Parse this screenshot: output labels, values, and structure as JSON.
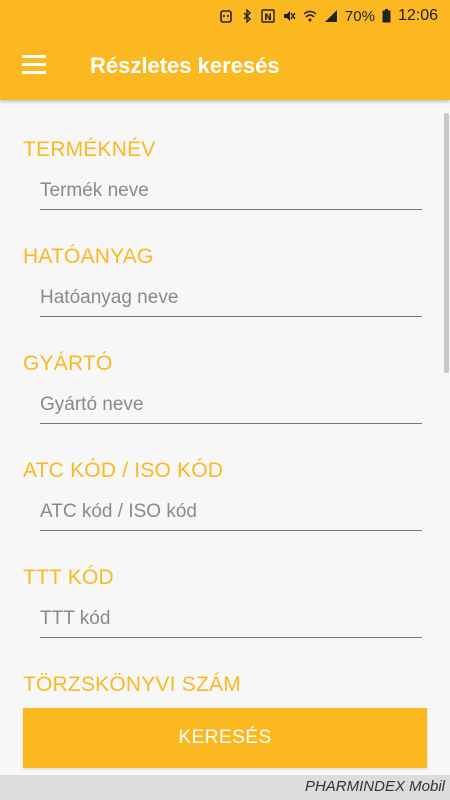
{
  "status_bar": {
    "battery": "70%",
    "time": "12:06",
    "icons": [
      "notification-icon",
      "bluetooth-icon",
      "nfc-icon",
      "mute-icon",
      "wifi-icon",
      "signal-icon",
      "battery-icon"
    ]
  },
  "app_bar": {
    "title": "Részletes keresés",
    "menu_icon": "hamburger-menu-icon"
  },
  "form": {
    "fields": [
      {
        "label": "TERMÉKNÉV",
        "placeholder": "Termék neve"
      },
      {
        "label": "HATÓANYAG",
        "placeholder": "Hatóanyag neve"
      },
      {
        "label": "GYÁRTÓ",
        "placeholder": "Gyártó neve"
      },
      {
        "label": "ATC KÓD / ISO KÓD",
        "placeholder": "ATC kód / ISO kód"
      },
      {
        "label": "TTT KÓD",
        "placeholder": "TTT kód"
      },
      {
        "label": "TÖRZSKÖNYVI SZÁM",
        "placeholder": ""
      }
    ]
  },
  "search_button": {
    "label": "KERESÉS"
  },
  "footer": {
    "text": "PHARMINDEX Mobil"
  },
  "colors": {
    "accent": "#fbb820",
    "background": "#f7f7f7",
    "footer": "#dcdcdc"
  }
}
